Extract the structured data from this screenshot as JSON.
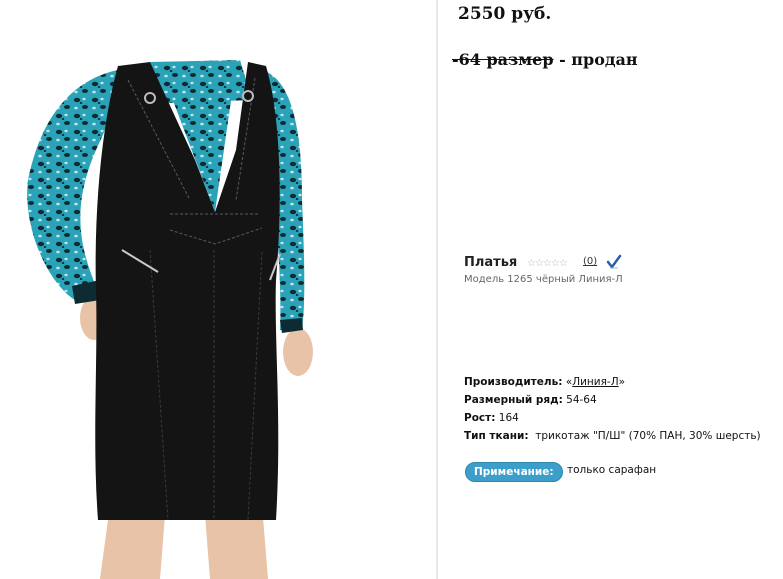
{
  "listing": {
    "price": "2550 руб.",
    "sold_size_struck": "-64 размер",
    "sold_separator": " - ",
    "sold_status": "продан"
  },
  "product": {
    "category": "Платья",
    "rating_stars": "☆☆☆☆☆",
    "rating_count": "(0)",
    "model": "Модель 1265 чёрный Линия-Л",
    "check_icon": "check-mark-icon"
  },
  "specs": {
    "manufacturer_label": "Производитель:",
    "manufacturer_open": "«",
    "manufacturer_value": "Линия-Л",
    "manufacturer_close": "»",
    "size_label": "Размерный ряд:",
    "size_value": "54-64",
    "height_label": "Рост:",
    "height_value": "164",
    "fabric_label": "Тип ткани:",
    "fabric_value": "трикотаж \"П/Ш\" (70% ПАН, 30% шерсть)",
    "note_label": "Примечание:",
    "note_value": "только сарафан"
  },
  "colors": {
    "dress": "#141414",
    "leopard": "#2aa3b8",
    "badge": "#3d9fc9"
  }
}
